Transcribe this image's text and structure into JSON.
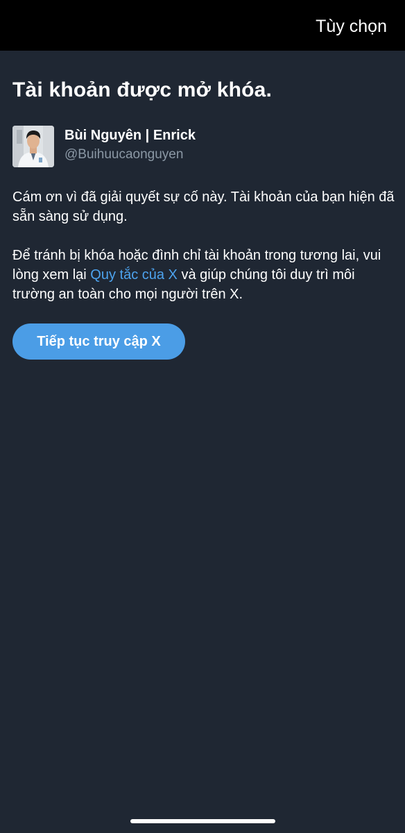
{
  "header": {
    "options_label": "Tùy chọn"
  },
  "main": {
    "title": "Tài khoản được mở khóa.",
    "profile": {
      "display_name": "Bùi Nguyên | Enrick",
      "handle": "@Buihuucaonguyen",
      "avatar_icon": "avatar-photo"
    },
    "paragraph1": "Cám ơn vì đã giải quyết sự cố này. Tài khoản của bạn hiện đã sẵn sàng sử dụng.",
    "paragraph2": {
      "before_link": "Để tránh bị khóa hoặc đình chỉ tài khoản trong tương lai, vui lòng xem lại ",
      "link_text": "Quy tắc của X",
      "after_link": " và giúp chúng tôi duy trì môi trường an toàn cho mọi người trên X."
    },
    "continue_button": "Tiếp tục truy cập X"
  },
  "colors": {
    "background": "#1f2733",
    "topbar": "#000000",
    "accent": "#4b9de6",
    "link": "#4da3ee",
    "secondary_text": "#8b98a5"
  }
}
